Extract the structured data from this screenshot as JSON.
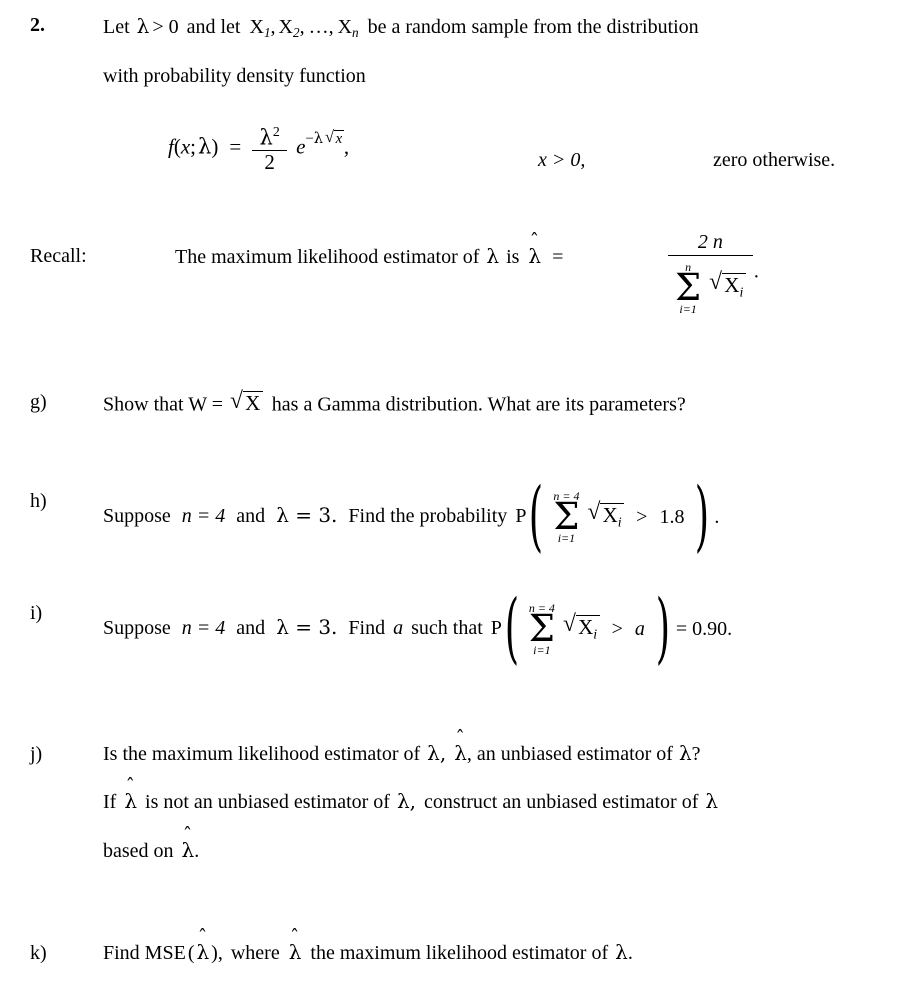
{
  "document": {
    "problem_number": "2.",
    "background_color": "#ffffff",
    "text_color": "#000000"
  },
  "intro": {
    "line1_a": "Let",
    "lambda": "λ",
    "line1_b": "> 0",
    "line1_c": "and  let",
    "X": "X",
    "sub1": "1",
    "sub2": "2",
    "subn": "n",
    "comma": ",",
    "ellipsis": "…",
    "line1_d": "be a random sample from the distribution",
    "line2": "with probability density function"
  },
  "pdf_formula": {
    "f": "f",
    "open": "(",
    "x": "x",
    "semicolon": ";",
    "lambda": "λ",
    "close": ")",
    "equals": "=",
    "numerator_base": "λ",
    "numerator_exp": "2",
    "denominator": "2",
    "e": "e",
    "minus": "−",
    "exp_lambda": "λ",
    "radicand": "x",
    "trailing_comma": ",",
    "support": "x > 0,",
    "otherwise": "zero  otherwise."
  },
  "recall": {
    "label": "Recall:",
    "text_a": "The maximum likelihood estimator of",
    "lambda": "λ",
    "text_b": "is",
    "lambda_hat": "λ",
    "hat": "ˆ",
    "equals": "=",
    "numerator": "2 n",
    "sum_top": "n",
    "sum_sign": "Σ",
    "sum_bottom": "i=1",
    "radicand_X": "X",
    "radicand_sub": "i",
    "period": "."
  },
  "parts": [
    {
      "label": "g)",
      "text_a": "Show that  W =",
      "radicand": "X",
      "text_b": "has a Gamma distribution.  What are its parameters?"
    },
    {
      "label": "h)",
      "text_a": "Suppose",
      "n_eq": "n = 4",
      "and": "and",
      "lambda_eq": "λ = 3.",
      "text_b": "Find the probability",
      "P": "P",
      "sum_top": "n = 4",
      "sum_sign": "Σ",
      "sum_bottom": "i=1",
      "radicand_X": "X",
      "radicand_sub": "i",
      "relation": ">",
      "value": "1.8",
      "tail": "."
    },
    {
      "label": "i)",
      "text_a": "Suppose",
      "n_eq": "n = 4",
      "and": "and",
      "lambda_eq": "λ = 3.",
      "text_b": "Find",
      "a": "a",
      "text_c": "such that",
      "P": "P",
      "sum_top": "n = 4",
      "sum_sign": "Σ",
      "sum_bottom": "i=1",
      "radicand_X": "X",
      "radicand_sub": "i",
      "relation": ">",
      "value": "a",
      "tail": "= 0.90."
    },
    {
      "label": "j)",
      "line1_a": "Is the maximum likelihood estimator of",
      "line1_lambda": "λ,",
      "line1_lambdahat": "λ",
      "line1_b": ", an unbiased estimator of",
      "line1_lambda2": "λ",
      "line1_q": "?",
      "line2_a": "If",
      "line2_lambdahat": "λ",
      "line2_b": "is not an unbiased estimator of",
      "line2_lambda": "λ,",
      "line2_c": "construct an unbiased estimator of",
      "line2_lambda2": "λ",
      "line3_a": "based on",
      "line3_lambdahat": "λ",
      "line3_b": "."
    },
    {
      "label": "k)",
      "text_a": "Find  MSE",
      "open": "(",
      "lambda_hat": "λ",
      "close": ")",
      "comma": ",",
      "text_b": "where",
      "lambda_hat2": "λ",
      "text_c": "the maximum likelihood estimator of",
      "lambda": "λ",
      "period": "."
    }
  ],
  "glyphs": {
    "hat": "ˆ",
    "sum": "Σ",
    "radical": "√",
    "lparen": "(",
    "rparen": ")"
  }
}
